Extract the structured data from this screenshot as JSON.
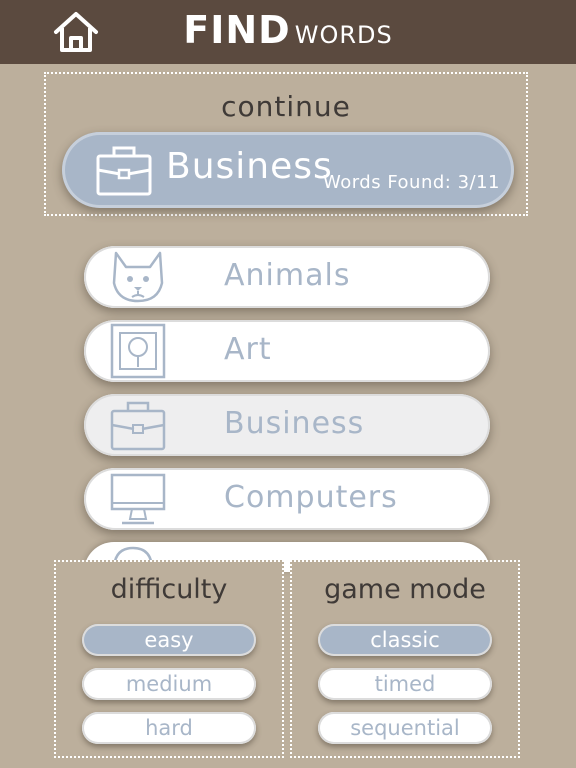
{
  "header": {
    "title_bold": "FIND",
    "title_light": "WORDS",
    "home_icon": "home-icon"
  },
  "continue": {
    "label": "continue",
    "category": "Business",
    "progress_text": "Words Found: 3/11",
    "icon": "briefcase-icon"
  },
  "categories": [
    {
      "label": "Animals",
      "icon": "cat-face-icon",
      "selected": false
    },
    {
      "label": "Art",
      "icon": "framed-picture-icon",
      "selected": false
    },
    {
      "label": "Business",
      "icon": "briefcase-icon",
      "selected": true
    },
    {
      "label": "Computers",
      "icon": "computer-monitor-icon",
      "selected": false
    }
  ],
  "difficulty": {
    "title": "difficulty",
    "options": [
      "easy",
      "medium",
      "hard"
    ],
    "selected": "easy"
  },
  "game_mode": {
    "title": "game mode",
    "options": [
      "classic",
      "timed",
      "sequential"
    ],
    "selected": "classic"
  },
  "colors": {
    "background": "#bcaf9c",
    "header": "#5b4a3f",
    "accent": "#a8b6c8"
  }
}
